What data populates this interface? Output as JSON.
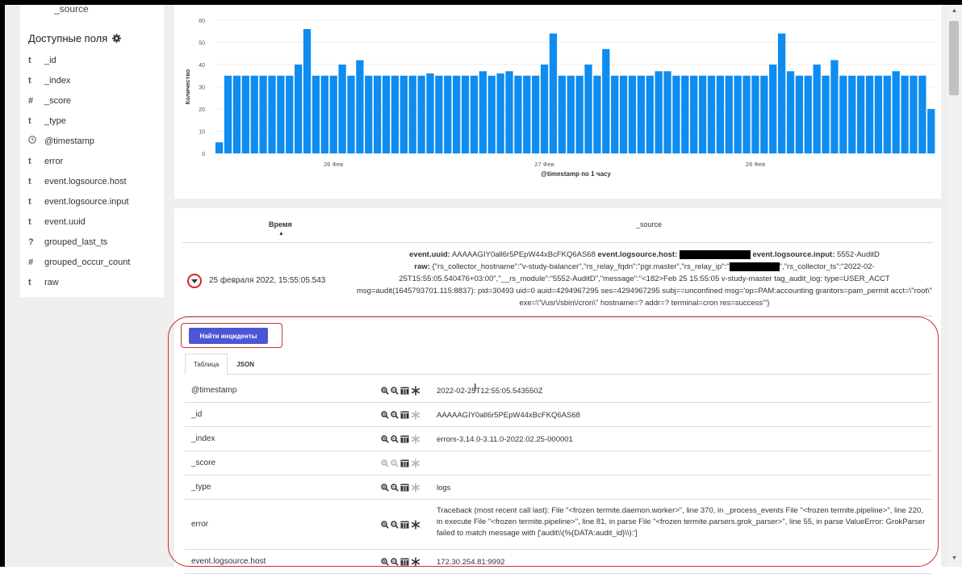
{
  "sidebar": {
    "truncated_item": "_source",
    "title": "Доступные поля",
    "fields": [
      {
        "type": "t",
        "name": "_id"
      },
      {
        "type": "t",
        "name": "_index"
      },
      {
        "type": "#",
        "name": "_score"
      },
      {
        "type": "t",
        "name": "_type"
      },
      {
        "type": "clock",
        "name": "@timestamp"
      },
      {
        "type": "t",
        "name": "error"
      },
      {
        "type": "t",
        "name": "event.logsource.host"
      },
      {
        "type": "t",
        "name": "event.logsource.input"
      },
      {
        "type": "t",
        "name": "event.uuid"
      },
      {
        "type": "?",
        "name": "grouped_last_ts"
      },
      {
        "type": "#",
        "name": "grouped_occur_count"
      },
      {
        "type": "t",
        "name": "raw"
      }
    ]
  },
  "chart_data": {
    "type": "bar",
    "ylabel": "Количество",
    "xlabel": "@timestamp по 1 часу",
    "ylim": [
      0,
      60
    ],
    "yticks": [
      0,
      10,
      20,
      30,
      40,
      50,
      60
    ],
    "xtick_labels": [
      "26 Фев",
      "27 Фев",
      "28 Фев"
    ],
    "xtick_index": [
      13,
      37,
      61
    ],
    "color": "#0f8cf0",
    "values": [
      5,
      35,
      35,
      35,
      35,
      35,
      35,
      35,
      35,
      40,
      56,
      35,
      35,
      35,
      40,
      35,
      42,
      35,
      35,
      35,
      35,
      35,
      35,
      35,
      36,
      35,
      35,
      35,
      35,
      35,
      37,
      35,
      36,
      37,
      35,
      35,
      35,
      40,
      54,
      35,
      35,
      35,
      40,
      35,
      47,
      35,
      35,
      35,
      35,
      35,
      37,
      37,
      35,
      35,
      35,
      35,
      35,
      35,
      35,
      35,
      35,
      35,
      35,
      40,
      54,
      37,
      35,
      35,
      40,
      35,
      42,
      35,
      35,
      35,
      35,
      35,
      35,
      37,
      35,
      35,
      35,
      20
    ]
  },
  "table": {
    "header_time": "Время",
    "header_source": "_source",
    "row": {
      "time": "25 февраля 2022, 15:55:05.543",
      "source_line1_k1": "event.uuid:",
      "source_line1_v1": " AAAAAGIY0all6r5PEpW44xBcFKQ6AS68 ",
      "source_line1_k2": "event.logsource.host:",
      "source_line1_k3": "event.logsource.input:",
      "source_line1_v3": " 5552-AuditD",
      "raw_key": "raw:",
      "raw_a": " {\"rs_collector_hostname\":\"v-study-balancer\",\"rs_relay_fqdn\":\"pgr.master\",\"rs_relay_ip\":\"",
      "raw_b": "\",\"rs_collector_ts\":\"2022-02-25T15:55:05.540476+03:00\",\"__rs_module\":\"5552-AuditD\",\"message\":\"<182>Feb 25 15:55:05 v-study-master tag_audit_log: type=USER_ACCT msg=audit(1645793701.115:8837): pid=30493 uid=0 auid=4294967295 ses=4294967295 subj==unconfined msg='op=PAM:accounting grantors=pam_permit acct=\\\"root\\\" exe=\\\"\\/usr\\/sbin\\/cron\\\" hostname=? addr=? terminal=cron res=success'\"}"
    }
  },
  "details": {
    "find_button": "Найти инциденты",
    "tab_table": "Таблица",
    "tab_json": "JSON",
    "rows": [
      {
        "key": "@timestamp",
        "value": "2022-02-25T12:55:05.543550Z"
      },
      {
        "key": "_id",
        "value": "AAAAAGIY0all6r5PEpW44xBcFKQ6AS68"
      },
      {
        "key": "_index",
        "value": "errors-3.14.0-3.11.0-2022.02.25-000001"
      },
      {
        "key": "_score",
        "value": ""
      },
      {
        "key": "_type",
        "value": "logs"
      },
      {
        "key": "error",
        "value": "Traceback (most recent call last): File \"<frozen termite.daemon.worker>\", line 370, in _process_events File \"<frozen termite.pipeline>\", line 220, in execute File \"<frozen termite.pipeline>\", line 81, in parse File \"<frozen termite.parsers.grok_parser>\", line 55, in parse ValueError: GrokParser failed to match message with ['audit\\\\(%{DATA:audit_id}\\\\):']"
      },
      {
        "key": "event.logsource.host",
        "value": "172.30.254.81:9992"
      }
    ]
  }
}
